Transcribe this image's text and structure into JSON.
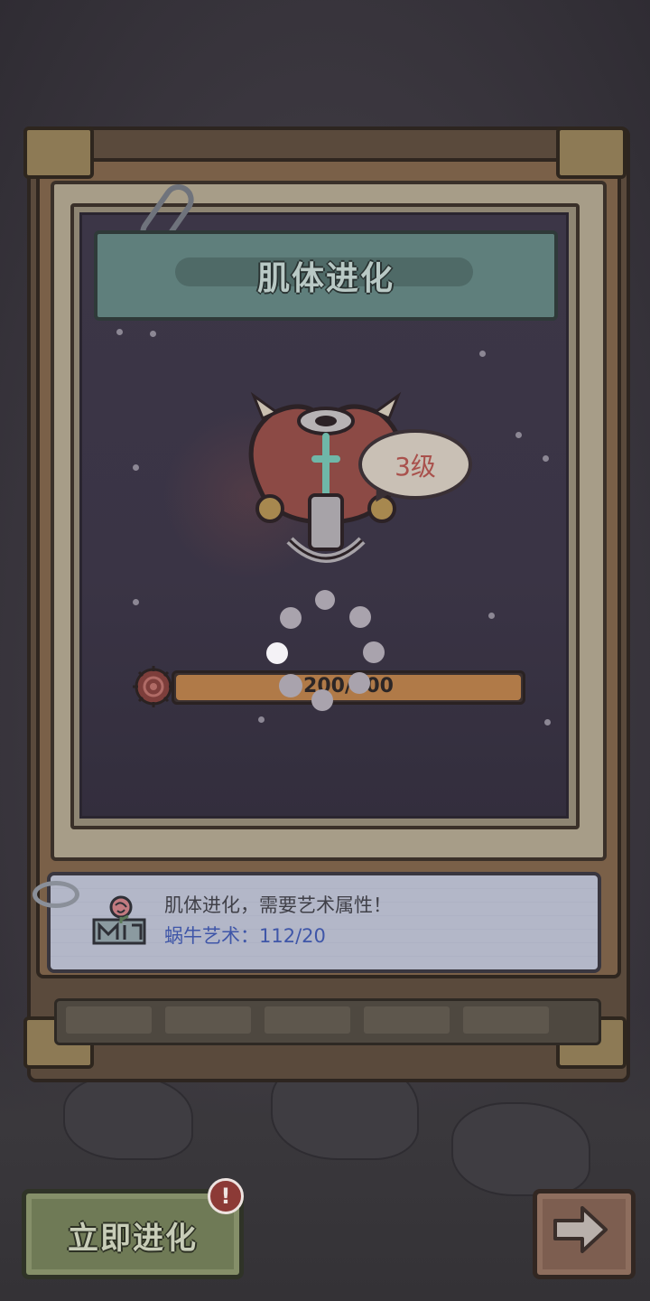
{
  "title": "肌体进化",
  "level_bubble": "3级",
  "progress": {
    "text": "200/200",
    "fill_fraction": 1.0
  },
  "info": {
    "line1": "肌体进化，需要艺术属性！",
    "line2": "蜗牛艺术：112/20"
  },
  "buttons": {
    "evolve_label": "立即进化",
    "evolve_badge": "!",
    "next_icon": "arrow-right-icon"
  },
  "colors": {
    "title_banner": "#5f7f7c",
    "progress_fill": "#b07a48",
    "evolve_button": "#6f7a56",
    "next_button": "#7d5e50",
    "info_value": "#3f56a8",
    "level_text": "#a9514c"
  }
}
